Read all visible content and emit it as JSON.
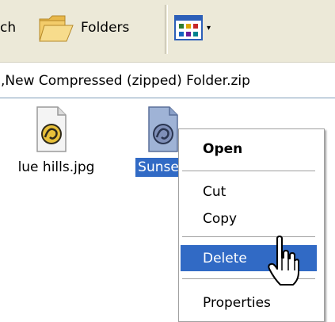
{
  "toolbar": {
    "search_label": "ch",
    "folders_label": "Folders",
    "views_icon": "views-icon",
    "dropdown_glyph": "▾"
  },
  "address": {
    "path": ",New Compressed (zipped) Folder.zip"
  },
  "files": [
    {
      "name": "Blue hills.jpg",
      "visible_label": "lue hills.jpg",
      "icon": "image-file-icon",
      "selected": false
    },
    {
      "name": "Sunset.jpg",
      "visible_label": "Sunse",
      "icon": "image-file-icon",
      "selected": true
    }
  ],
  "context_menu": {
    "open_label": "Open",
    "cut_label": "Cut",
    "copy_label": "Copy",
    "delete_label": "Delete",
    "properties_label": "Properties",
    "highlighted": "Delete"
  },
  "colors": {
    "toolbar_bg": "#ece9d8",
    "selection": "#316ac5",
    "menu_bg": "#ffffff"
  }
}
